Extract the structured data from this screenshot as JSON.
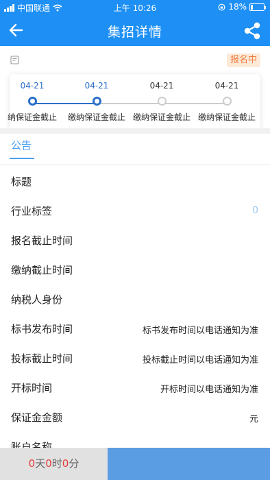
{
  "statusbar": {
    "carrier": "中国联通",
    "time": "上午 10:26",
    "battery": "18%",
    "battery_level": 0.18
  },
  "navbar": {
    "title": "集招详情",
    "back_icon": "back-arrow-icon",
    "share_icon": "share-icon"
  },
  "status_badge": "报名中",
  "timeline": [
    {
      "date": "04-21",
      "label": "纳保证金截止",
      "active": true
    },
    {
      "date": "04-21",
      "label": "缴纳保证金截止",
      "active": true
    },
    {
      "date": "04-21",
      "label": "缴纳保证金截止",
      "active": false
    },
    {
      "date": "04-21",
      "label": "缴纳保证金截止",
      "active": false
    }
  ],
  "tab": {
    "label": "公告"
  },
  "rows": [
    {
      "label": "标题",
      "value": ""
    },
    {
      "label": "行业标签",
      "value": "0"
    },
    {
      "label": "报名截止时间",
      "value": ""
    },
    {
      "label": "缴纳截止时间",
      "value": ""
    },
    {
      "label": "纳税人身份",
      "value": ""
    },
    {
      "label": "标书发布时间",
      "value": "标书发布时间以电话通知为准"
    },
    {
      "label": "投标截止时间",
      "value": "投标截止时间以电话通知为准"
    },
    {
      "label": "开标时间",
      "value": "开标时间以电话通知为准"
    },
    {
      "label": "保证金金额",
      "value": "元"
    },
    {
      "label": "账户名称",
      "value": ""
    }
  ],
  "countdown": {
    "days": "0",
    "days_unit": "天",
    "hours": "0",
    "hours_unit": "时",
    "minutes": "0",
    "minutes_unit": "分"
  },
  "colors": {
    "primary": "#1e90f5",
    "active_step": "#2a6fc9",
    "inactive_step": "#cccccc",
    "badge_bg": "#fde9d8",
    "badge_text": "#f07a3c",
    "countdown_number": "#e53935",
    "action_button": "#5b9de3"
  }
}
